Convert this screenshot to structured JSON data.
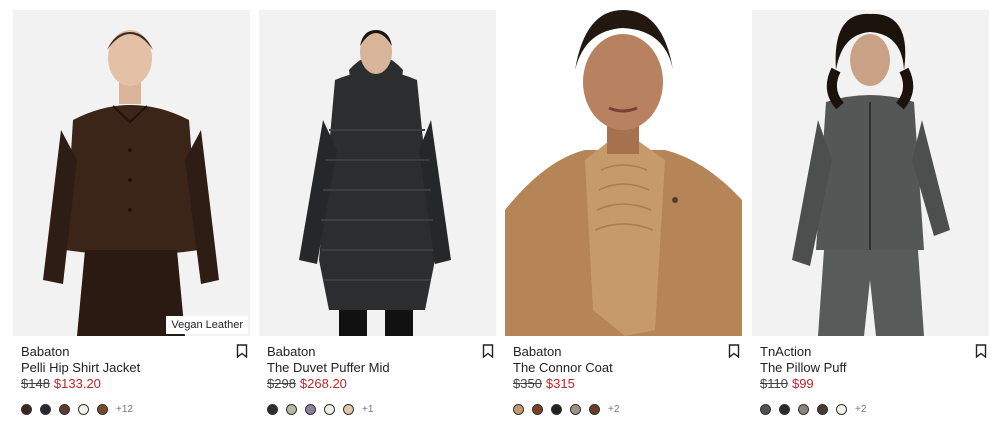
{
  "products": [
    {
      "brand": "Babaton",
      "name": "Pelli Hip Shirt Jacket",
      "original_price": "$148",
      "sale_price": "$133.20",
      "badge": "Vegan Leather",
      "image": "woman-in-brown-leather-shirt-jacket-and-skirt",
      "swatches": [
        "#3a2720",
        "#252a30",
        "#5a3c30",
        "#f4f1ea",
        "#7a4a30"
      ],
      "more_colors": "+12"
    },
    {
      "brand": "Babaton",
      "name": "The Duvet Puffer Mid",
      "original_price": "$298",
      "sale_price": "$268.20",
      "badge": "",
      "image": "woman-in-black-mid-length-puffer",
      "swatches": [
        "#2b2d2e",
        "#b7b8a6",
        "#8b819a",
        "#f0ede4",
        "#e0c9a4"
      ],
      "more_colors": "+1"
    },
    {
      "brand": "Babaton",
      "name": "The Connor Coat",
      "original_price": "$350",
      "sale_price": "$315",
      "badge": "",
      "image": "woman-in-camel-wool-coat-closeup",
      "swatches": [
        "#c49a70",
        "#7a4126",
        "#222222",
        "#9c9382",
        "#6e3c22"
      ],
      "more_colors": "+2"
    },
    {
      "brand": "TnAction",
      "name": "The Pillow Puff",
      "original_price": "$110",
      "sale_price": "$99",
      "badge": "",
      "image": "woman-in-grey-zip-jacket-and-leggings",
      "swatches": [
        "#4f5250",
        "#2b2b2b",
        "#8a8480",
        "#4a3a30",
        "#f3f0e8"
      ],
      "more_colors": "+2"
    }
  ],
  "colors": {
    "sale": "#c0242a",
    "text": "#1a1a1a",
    "photo_bg": "#f2f2f2"
  },
  "icons": {
    "bookmark": "bookmark-icon"
  }
}
